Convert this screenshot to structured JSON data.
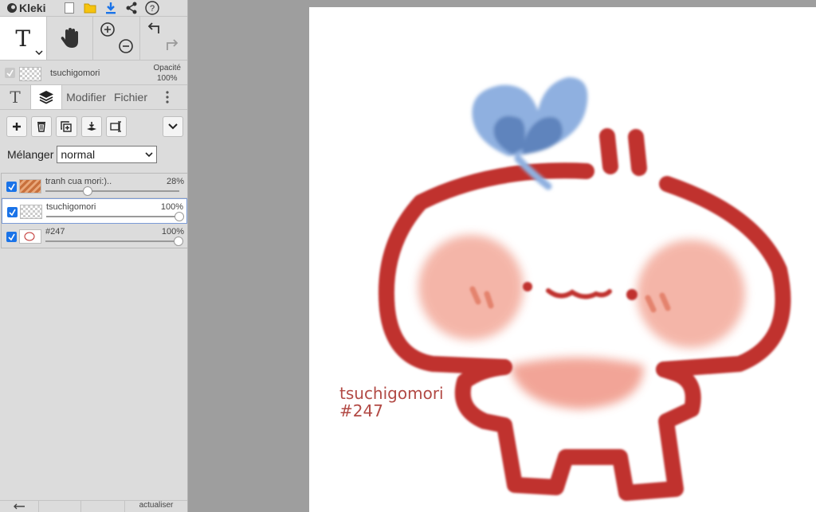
{
  "app": {
    "name": "Kleki"
  },
  "toolbar": {
    "text_tool_label": "T",
    "icons": [
      "new-file-icon",
      "open-folder-icon",
      "download-icon",
      "share-icon",
      "help-icon"
    ]
  },
  "layer_info": {
    "name": "tsuchigomori",
    "opacity_label": "Opacité",
    "opacity_value": "100%"
  },
  "tabs": [
    {
      "label": "T",
      "icon": "text-tab-icon"
    },
    {
      "label": "",
      "icon": "layers-icon"
    },
    {
      "label": "Modifier"
    },
    {
      "label": "Fichier"
    }
  ],
  "blend": {
    "label": "Mélanger",
    "value": "normal"
  },
  "layers": [
    {
      "name": "tranh cua mori:)..",
      "opacity": "28%",
      "level": 0.28,
      "checked": true
    },
    {
      "name": "tsuchigomori",
      "opacity": "100%",
      "level": 1.0,
      "checked": true,
      "active": true
    },
    {
      "name": "#247",
      "opacity": "100%",
      "level": 1.0,
      "checked": true
    }
  ],
  "footer": {
    "right_label": "actualiser"
  },
  "canvas": {
    "signature_name": "tsuchigomori",
    "signature_number": "#247"
  },
  "colors": {
    "accent": "#1a73e8",
    "drawing_red": "#c0302e",
    "leaf_blue": "#8fb0e0",
    "cheek_pink": "#f3a99a"
  }
}
